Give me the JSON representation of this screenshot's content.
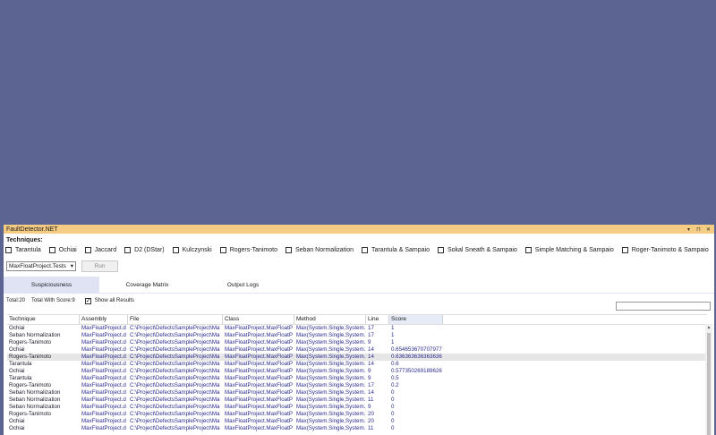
{
  "window": {
    "title": "FaultDetector.NET",
    "controls": [
      "▾",
      "⊓",
      "✕"
    ]
  },
  "techniques_label": "Techniques:",
  "techniques": [
    {
      "label": "Tarantula",
      "checked": false
    },
    {
      "label": "Ochiai",
      "checked": false
    },
    {
      "label": "Jaccard",
      "checked": false
    },
    {
      "label": "D2 (DStar)",
      "checked": false
    },
    {
      "label": "Kulczynski",
      "checked": false
    },
    {
      "label": "Rogers-Tanimoto",
      "checked": false
    },
    {
      "label": "Seban Normalization",
      "checked": false
    },
    {
      "label": "Tarantula & Sampaio",
      "checked": false
    },
    {
      "label": "Sokal Sneath & Sampaio",
      "checked": false
    },
    {
      "label": "Simple Matching & Sampaio",
      "checked": false
    },
    {
      "label": "Roger-Tanimoto & Sampaio",
      "checked": false
    }
  ],
  "project_select": {
    "value": "MaxFloatProject.Tests"
  },
  "run_button": "Run",
  "tabs": [
    {
      "label": "Suspiciousness",
      "active": true
    },
    {
      "label": "Coverage Matrix",
      "active": false
    },
    {
      "label": "Output Logs",
      "active": false
    }
  ],
  "stats": {
    "total": "Total:20",
    "total_with_score": "Total With Score:9",
    "show_all_label": "Show all Results",
    "show_all_checked": true
  },
  "columns": [
    "Technique",
    "Assembly",
    "File",
    "Class",
    "Method",
    "Line",
    "Score"
  ],
  "rows": [
    [
      "Ochiai",
      "MaxFloatProject.d",
      "C:\\Project\\DefectsSampleProject\\Ma",
      "MaxFloatProject.MaxFloatP",
      "Max(System.Single,System.!",
      "17",
      "1"
    ],
    [
      "Seban Normalization",
      "MaxFloatProject.d",
      "C:\\Project\\DefectsSampleProject\\Ma",
      "MaxFloatProject.MaxFloatP",
      "Max(System.Single,System.!",
      "17",
      "1"
    ],
    [
      "Rogers-Tanimoto",
      "MaxFloatProject.d",
      "C:\\Project\\DefectsSampleProject\\Ma",
      "MaxFloatProject.MaxFloatP",
      "Max(System.Single,System.!",
      "9",
      "1"
    ],
    [
      "Ochiai",
      "MaxFloatProject.d",
      "C:\\Project\\DefectsSampleProject\\Ma",
      "MaxFloatProject.MaxFloatP",
      "Max(System.Single,System.!",
      "14",
      "0.654653670707977"
    ],
    [
      "Rogers-Tanimoto",
      "MaxFloatProject.d",
      "C:\\Project\\DefectsSampleProject\\Ma",
      "MaxFloatProject.MaxFloatP",
      "Max(System.Single,System.!",
      "14",
      "0.636363636363636"
    ],
    [
      "Tarantula",
      "MaxFloatProject.d",
      "C:\\Project\\DefectsSampleProject\\Ma",
      "MaxFloatProject.MaxFloatP",
      "Max(System.Single,System.!",
      "14",
      "0.6"
    ],
    [
      "Ochiai",
      "MaxFloatProject.d",
      "C:\\Project\\DefectsSampleProject\\Ma",
      "MaxFloatProject.MaxFloatP",
      "Max(System.Single,System.!",
      "9",
      "0.577350269189626"
    ],
    [
      "Tarantula",
      "MaxFloatProject.d",
      "C:\\Project\\DefectsSampleProject\\Ma",
      "MaxFloatProject.MaxFloatP",
      "Max(System.Single,System.!",
      "9",
      "0.5"
    ],
    [
      "Rogers-Tanimoto",
      "MaxFloatProject.d",
      "C:\\Project\\DefectsSampleProject\\Ma",
      "MaxFloatProject.MaxFloatP",
      "Max(System.Single,System.!",
      "17",
      "0.2"
    ],
    [
      "Seban Normalization",
      "MaxFloatProject.d",
      "C:\\Project\\DefectsSampleProject\\Ma",
      "MaxFloatProject.MaxFloatP",
      "Max(System.Single,System.!",
      "14",
      "0"
    ],
    [
      "Seban Normalization",
      "MaxFloatProject.d",
      "C:\\Project\\DefectsSampleProject\\Ma",
      "MaxFloatProject.MaxFloatP",
      "Max(System.Single,System.!",
      "11",
      "0"
    ],
    [
      "Seban Normalization",
      "MaxFloatProject.d",
      "C:\\Project\\DefectsSampleProject\\Ma",
      "MaxFloatProject.MaxFloatP",
      "Max(System.Single,System.!",
      "9",
      "0"
    ],
    [
      "Rogers-Tanimoto",
      "MaxFloatProject.d",
      "C:\\Project\\DefectsSampleProject\\Ma",
      "MaxFloatProject.MaxFloatP",
      "Max(System.Single,System.!",
      "20",
      "0"
    ],
    [
      "Ochiai",
      "MaxFloatProject.d",
      "C:\\Project\\DefectsSampleProject\\Ma",
      "MaxFloatProject.MaxFloatP",
      "Max(System.Single,System.!",
      "20",
      "0"
    ],
    [
      "Ochiai",
      "MaxFloatProject.d",
      "C:\\Project\\DefectsSampleProject\\Ma",
      "MaxFloatProject.MaxFloatP",
      "Max(System.Single,System.!",
      "11",
      "0"
    ]
  ],
  "selected_row": 4,
  "colors": {
    "background": "#5c6491",
    "titlebar": "#f5cc84",
    "active_tab": "#dfe3f4",
    "link_text": "#2b2b8f"
  }
}
